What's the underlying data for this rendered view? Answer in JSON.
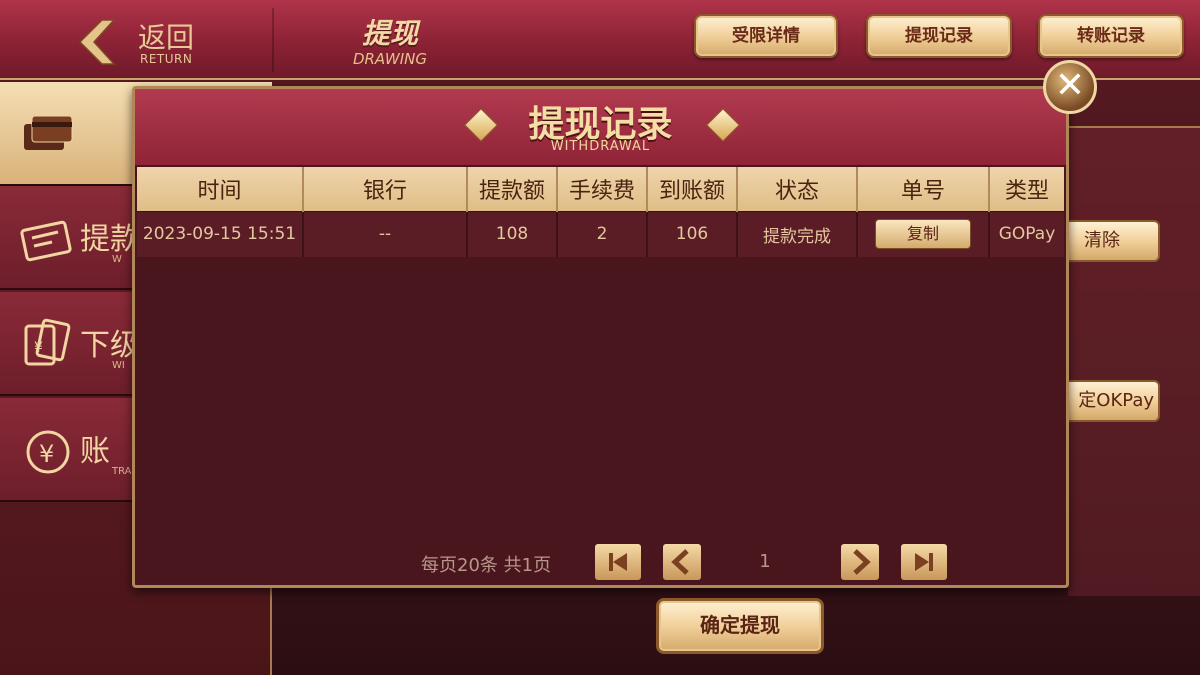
{
  "header": {
    "back_label": "返回",
    "back_sub": "RETURN",
    "title": "提现",
    "title_sub": "DRAWING",
    "buttons": [
      "受限详情",
      "提现记录",
      "转账记录"
    ]
  },
  "sidebar": {
    "items": [
      {
        "icon": "bank-card-icon",
        "label": "",
        "sub": ""
      },
      {
        "icon": "card-withdraw-icon",
        "label": "提款",
        "sub": "W"
      },
      {
        "icon": "wallet-icon",
        "label": "下级",
        "sub": "WI"
      },
      {
        "icon": "yuan-exchange-icon",
        "label": "账",
        "sub": "TRA"
      }
    ]
  },
  "background_buttons": {
    "clear": "清除",
    "bind_okpay": "定OKPay",
    "confirm": "确定提现"
  },
  "modal": {
    "title": "提现记录",
    "subtitle": "WITHDRAWAL",
    "columns": [
      "时间",
      "银行",
      "提款额",
      "手续费",
      "到账额",
      "状态",
      "单号",
      "类型"
    ],
    "rows": [
      {
        "time": "2023-09-15 15:51",
        "bank": "--",
        "amount": "108",
        "fee": "2",
        "received": "106",
        "status": "提款完成",
        "order_button": "复制",
        "type": "GOPay"
      }
    ],
    "pagination": {
      "info": "每页20条  共1页",
      "current_page": "1"
    }
  },
  "colors": {
    "accent_gold": "#e8c894",
    "header_red": "#8c2235",
    "modal_bg": "#4a161d"
  }
}
